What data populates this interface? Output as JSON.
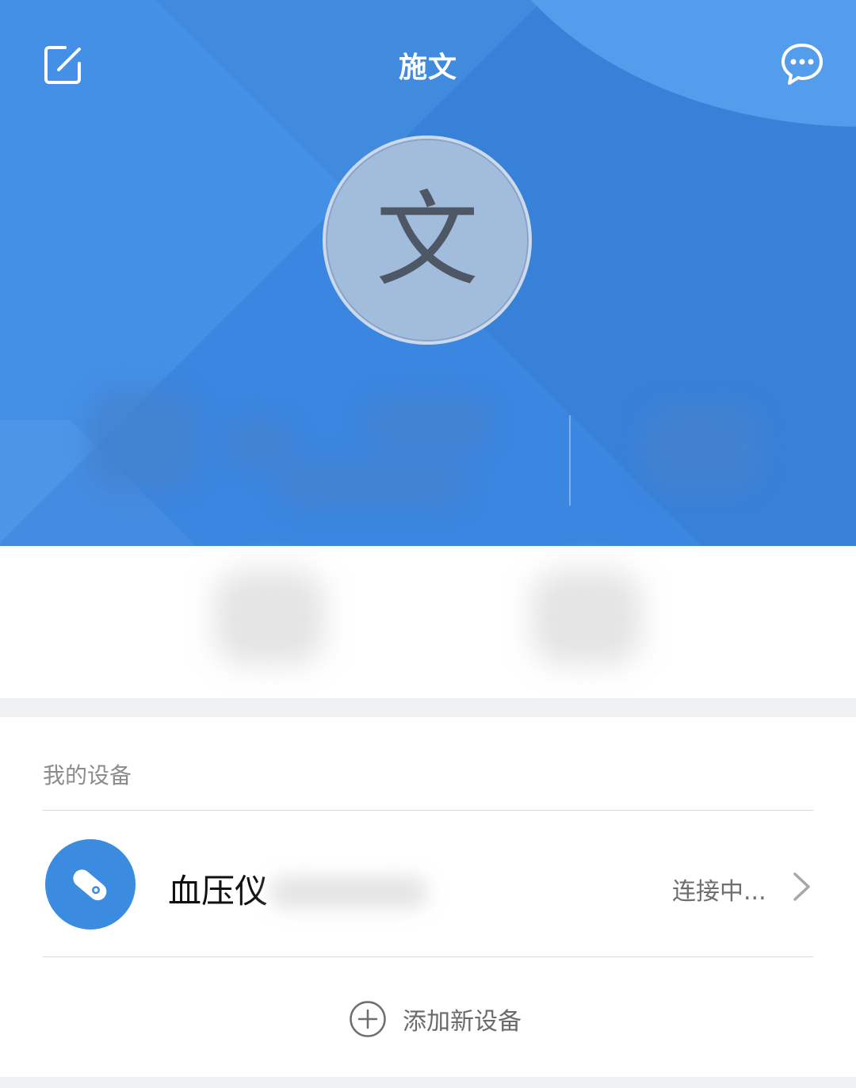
{
  "header": {
    "title": "施文",
    "avatar_text": "文",
    "edit_icon": "edit-icon",
    "chat_icon": "chat-bubble-icon",
    "colors": {
      "primary": "#3a86e0",
      "circle": "#549ded",
      "avatar_bg": "#a2bcdc"
    }
  },
  "devices": {
    "section_title": "我的设备",
    "items": [
      {
        "name": "血压仪",
        "status": "连接中...",
        "icon": "blood-pressure-device-icon"
      }
    ],
    "add_label": "添加新设备",
    "add_icon": "plus-circle-icon"
  }
}
